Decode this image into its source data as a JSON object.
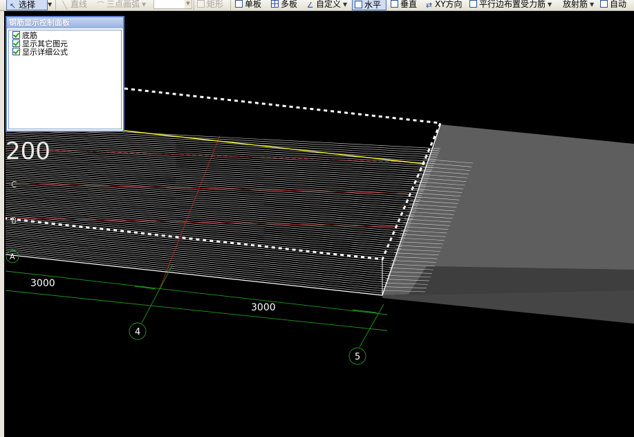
{
  "toolbar": {
    "select_label": "选择",
    "line_label": "直线",
    "arc_label": "三点画弧",
    "rect_label": "矩形",
    "single_board_label": "单板",
    "multi_board_label": "多板",
    "custom_label": "自定义",
    "horizontal_label": "水平",
    "vertical_label": "垂直",
    "xy_direction_label": "XY方向",
    "parallel_edge_label": "平行边布置受力筋",
    "radial_label": "放射筋",
    "auto_label": "自动"
  },
  "panel": {
    "title": "钢筋显示控制面板",
    "options": [
      {
        "label": "底筋",
        "checked": true
      },
      {
        "label": "显示其它图元",
        "checked": true
      },
      {
        "label": "显示详细公式",
        "checked": true
      }
    ]
  },
  "drawing": {
    "label_200": "200",
    "grid_axes": {
      "c": "C",
      "b": "B",
      "a": "A",
      "n4": "4",
      "n5": "5"
    },
    "dim_left": "3000",
    "dim_right": "3000"
  },
  "colors": {
    "background": "#000000",
    "rebar": "#ffffff",
    "axis_line": "#cc2222",
    "dimension": "#22aa22",
    "highlight_bar": "#ffff33",
    "adjacent_slab": "#666666"
  }
}
